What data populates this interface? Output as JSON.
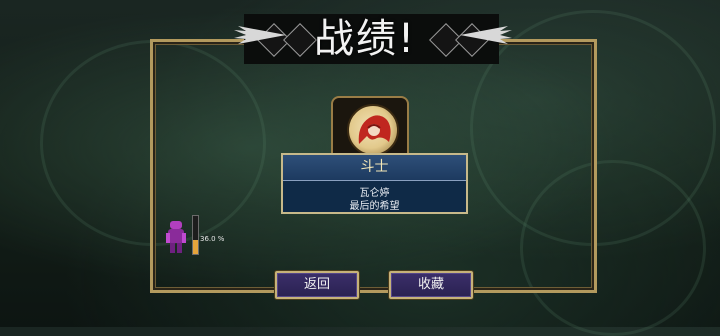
{
  "title": "战绩!",
  "card": {
    "name": "斗士",
    "line1": "瓦仑婷",
    "line2": "最后的希望"
  },
  "progress": {
    "label": "36.0 %",
    "fraction": 0.36
  },
  "buttons": {
    "back": "返回",
    "collect": "收藏"
  },
  "colors": {
    "frame_gold": "#b39a5e",
    "info_blue": "#0f2a47",
    "button_purple": "#3b2f6a",
    "progress_orange": "#e6a53b"
  }
}
